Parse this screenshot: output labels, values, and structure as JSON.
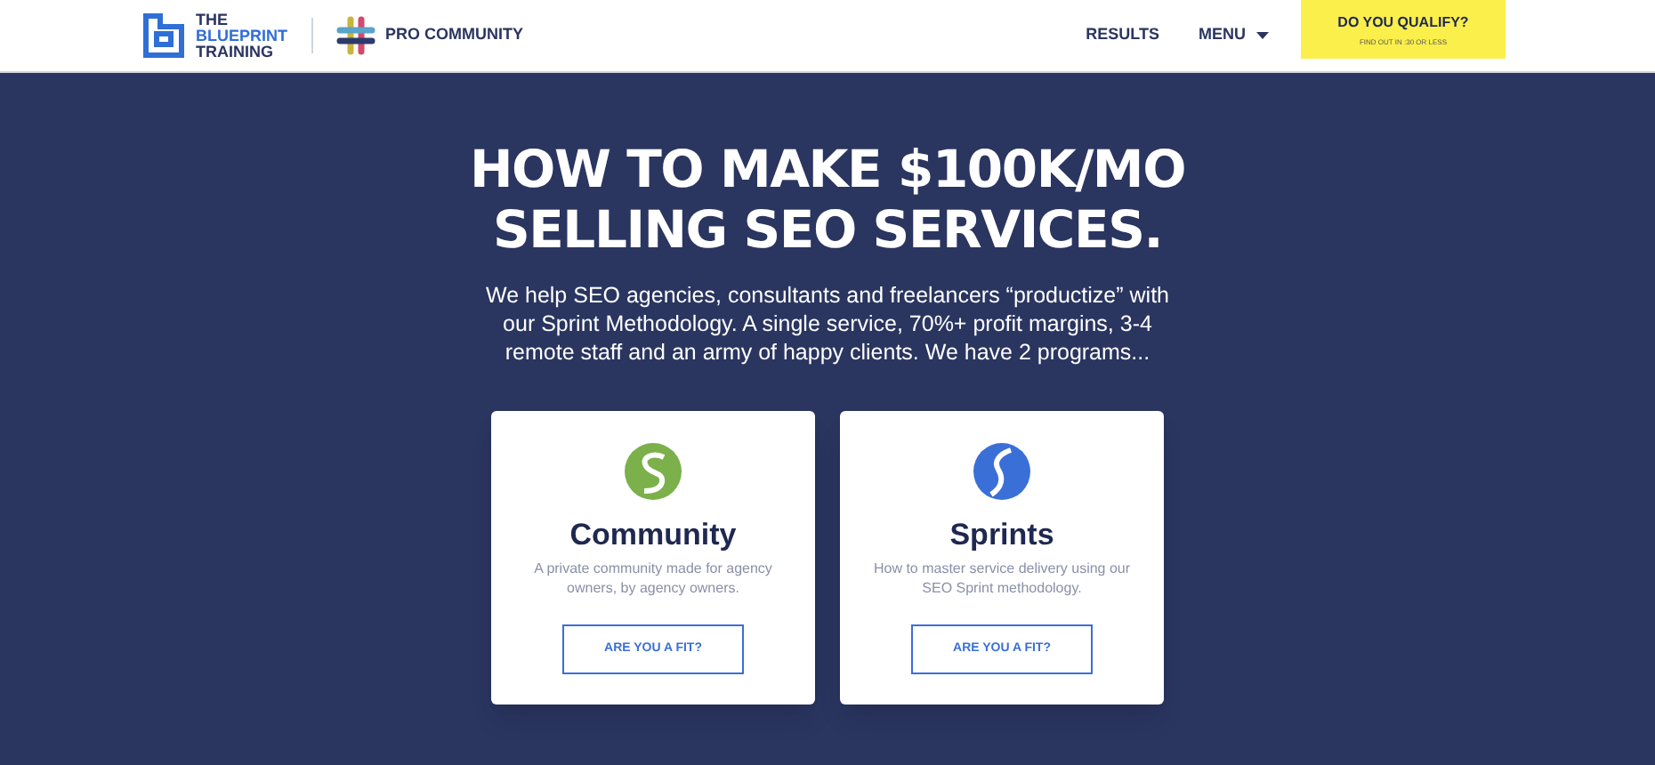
{
  "header": {
    "logo_lines": [
      "THE",
      "BLUEPRINT",
      "TRAINING"
    ],
    "partner": "PRO COMMUNITY",
    "nav": [
      {
        "label": "RESULTS",
        "dropdown": false
      },
      {
        "label": "MENU",
        "dropdown": true
      }
    ],
    "cta": {
      "title": "DO YOU QUALIFY?",
      "subtitle": "FIND OUT IN :30 OR LESS"
    }
  },
  "hero": {
    "title_lines": [
      "HOW TO MAKE $100K/MO",
      "SELLING SEO SERVICES."
    ],
    "text": "We help SEO agencies, consultants and freelancers “productize” with our Sprint Methodology. A single service, 70%+ profit margins, 3-4 remote staff and an army of happy clients. We have 2 programs..."
  },
  "cards": [
    {
      "kind": "community",
      "title": "Community",
      "text": "A private community made for agency owners, by agency owners.",
      "button": "ARE YOU A FIT?"
    },
    {
      "kind": "sprints",
      "title": "Sprints",
      "text": "How to master service delivery using our SEO Sprint methodology.",
      "button": "ARE YOU A FIT?"
    }
  ]
}
